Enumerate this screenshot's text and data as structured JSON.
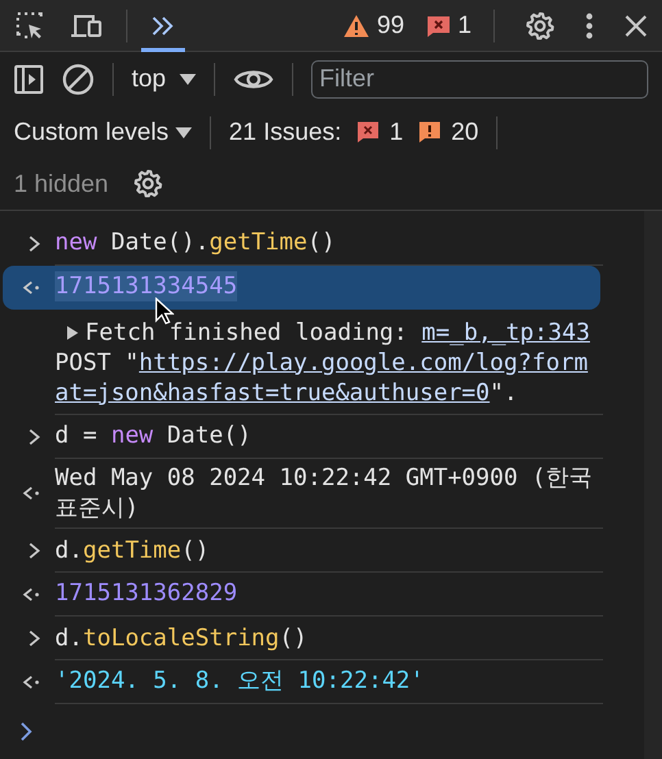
{
  "main_toolbar": {
    "warnings": "99",
    "errors": "1"
  },
  "console_toolbar": {
    "context": "top",
    "filter": {
      "placeholder": "Filter"
    }
  },
  "levels_bar": {
    "levels": "Custom levels",
    "issues": "21 Issues:",
    "issue_counts": [
      {
        "kind": "error",
        "count": "1"
      },
      {
        "kind": "warning",
        "count": "20"
      }
    ]
  },
  "hidden_bar": {
    "label": "1 hidden"
  },
  "entries": [
    {
      "kind": "input",
      "tokens": [
        {
          "kind": "keyword",
          "text": "new"
        },
        {
          "kind": "plain",
          "text": " Date()."
        },
        {
          "kind": "method",
          "text": "getTime"
        },
        {
          "kind": "plain",
          "text": "()"
        }
      ]
    },
    {
      "kind": "number",
      "value": "1715131334545",
      "selected": true
    },
    {
      "kind": "log",
      "expanded": false,
      "lines": [
        [
          {
            "text": "Fetch finished loading: ",
            "link": false
          },
          {
            "text": "m=_b,_tp:343",
            "link": true
          }
        ],
        [
          {
            "text": "POST \"",
            "link": false
          },
          {
            "text": "https://play.google.com/log?form",
            "link": true
          }
        ],
        [
          {
            "text": "at=json&hasfast=true&authuser=0",
            "link": true
          },
          {
            "text": "\".",
            "link": false
          }
        ]
      ]
    },
    {
      "kind": "input",
      "tokens": [
        {
          "kind": "plain",
          "text": "d = "
        },
        {
          "kind": "keyword",
          "text": "new"
        },
        {
          "kind": "plain",
          "text": " Date()"
        }
      ]
    },
    {
      "kind": "text",
      "value": "Wed May 08 2024 10:22:42 GMT+0900 (한국 표준시)",
      "selected": false
    },
    {
      "kind": "input",
      "tokens": [
        {
          "kind": "plain",
          "text": "d."
        },
        {
          "kind": "method",
          "text": "getTime"
        },
        {
          "kind": "plain",
          "text": "()"
        }
      ]
    },
    {
      "kind": "number",
      "value": "1715131362829",
      "selected": false
    },
    {
      "kind": "input",
      "tokens": [
        {
          "kind": "plain",
          "text": "d."
        },
        {
          "kind": "method",
          "text": "toLocaleString"
        },
        {
          "kind": "plain",
          "text": "()"
        }
      ]
    },
    {
      "kind": "string",
      "value": "'2024. 5. 8. 오전 10:22:42'",
      "selected": false
    }
  ]
}
